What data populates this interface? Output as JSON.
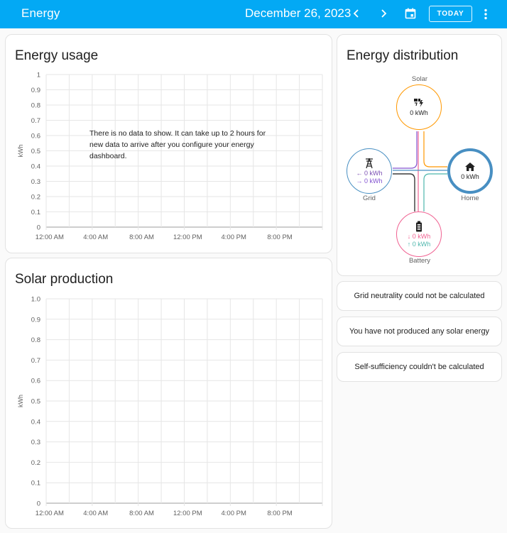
{
  "toolbar": {
    "title": "Energy",
    "date": "December 26, 2023",
    "today_label": "TODAY",
    "icons": [
      "chevron-left-icon",
      "chevron-right-icon",
      "calendar-icon",
      "more-vert-icon"
    ]
  },
  "energy_usage": {
    "title": "Energy usage",
    "no_data_text": "There is no data to show. It can take up to 2 hours for new data to arrive after you configure your energy dashboard."
  },
  "solar_production": {
    "title": "Solar production"
  },
  "distribution": {
    "title": "Energy distribution",
    "solar": {
      "label": "Solar",
      "value": "0 kWh",
      "color": "#ff9800"
    },
    "grid": {
      "label": "Grid",
      "import_value": "← 0 kWh",
      "export_value": "→ 0 kWh",
      "color": "#488fc2",
      "import_color": "#7b4fb3",
      "export_color": "#8353d1"
    },
    "home": {
      "label": "Home",
      "value": "0 kWh",
      "color": "#488fc2"
    },
    "battery": {
      "label": "Battery",
      "in_value": "↓ 0 kWh",
      "out_value": "↑ 0 kWh",
      "color": "#f06292",
      "in_color": "#f06292",
      "out_color": "#4db6ac"
    }
  },
  "info_cards": {
    "grid_neutrality": "Grid neutrality could not be calculated",
    "solar": "You have not produced any solar energy",
    "self_sufficiency": "Self-sufficiency couldn't be calculated"
  },
  "chart_data": [
    {
      "type": "bar",
      "title": "Energy usage",
      "ylabel": "kWh",
      "xlabel": "",
      "x_ticks": [
        "12:00 AM",
        "4:00 AM",
        "8:00 AM",
        "12:00 PM",
        "4:00 PM",
        "8:00 PM"
      ],
      "y_ticks": [
        "0",
        "0.1",
        "0.2",
        "0.3",
        "0.4",
        "0.5",
        "0.6",
        "0.7",
        "0.8",
        "0.9",
        "1"
      ],
      "ylim": [
        0,
        1
      ],
      "series": [],
      "grid": true
    },
    {
      "type": "bar",
      "title": "Solar production",
      "ylabel": "kWh",
      "xlabel": "",
      "x_ticks": [
        "12:00 AM",
        "4:00 AM",
        "8:00 AM",
        "12:00 PM",
        "4:00 PM",
        "8:00 PM"
      ],
      "y_ticks": [
        "0",
        "0.1",
        "0.2",
        "0.3",
        "0.4",
        "0.5",
        "0.6",
        "0.7",
        "0.8",
        "0.9",
        "1.0"
      ],
      "ylim": [
        0,
        1
      ],
      "series": [],
      "grid": true
    }
  ]
}
